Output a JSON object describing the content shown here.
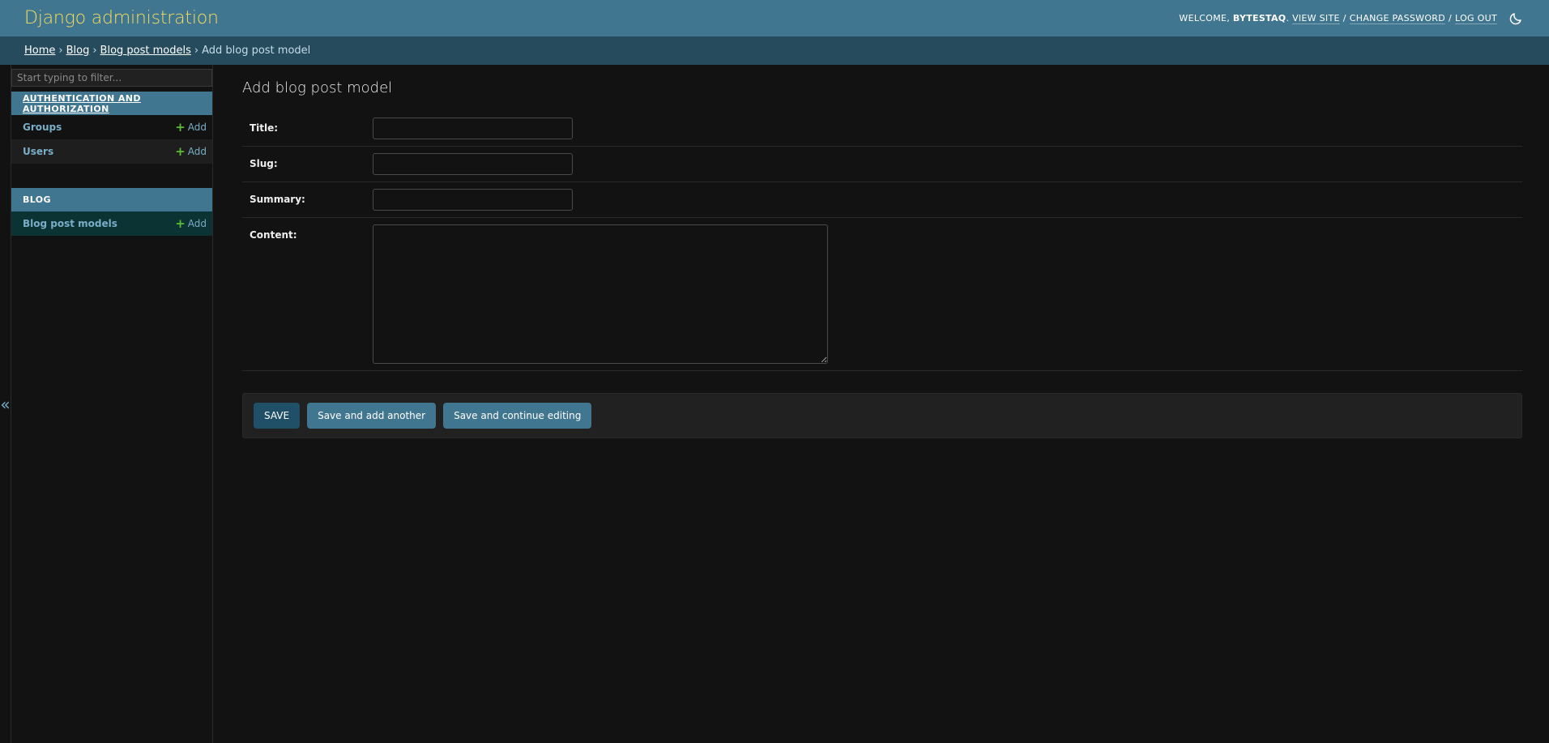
{
  "header": {
    "site_name": "Django administration",
    "welcome_label": "Welcome,",
    "username": "bytestaq",
    "view_site": "View site",
    "change_password": "Change password",
    "log_out": "Log out",
    "theme_icon": "moon-icon"
  },
  "breadcrumbs": {
    "home": "Home",
    "app": "Blog",
    "model": "Blog post models",
    "current": "Add blog post model"
  },
  "sidebar": {
    "filter_placeholder": "Start typing to filter...",
    "collapse_glyph": "«",
    "modules": [
      {
        "caption": "Authentication and Authorization",
        "models": [
          {
            "name": "Groups",
            "add_label": "Add"
          },
          {
            "name": "Users",
            "add_label": "Add"
          }
        ]
      },
      {
        "caption": "Blog",
        "models": [
          {
            "name": "Blog post models",
            "add_label": "Add"
          }
        ]
      }
    ]
  },
  "form": {
    "title": "Add blog post model",
    "fields": [
      {
        "label": "Title:",
        "value": ""
      },
      {
        "label": "Slug:",
        "value": ""
      },
      {
        "label": "Summary:",
        "value": ""
      },
      {
        "label": "Content:",
        "value": ""
      }
    ],
    "buttons": {
      "save": "Save",
      "save_add_another": "Save and add another",
      "save_continue": "Save and continue editing"
    }
  },
  "colors": {
    "header_bg": "#417690",
    "breadcrumb_bg": "#264b5d",
    "site_name": "#f5dd5d",
    "link": "#79aec8",
    "add_plus": "#5cbd34",
    "save_button": "#205067"
  }
}
